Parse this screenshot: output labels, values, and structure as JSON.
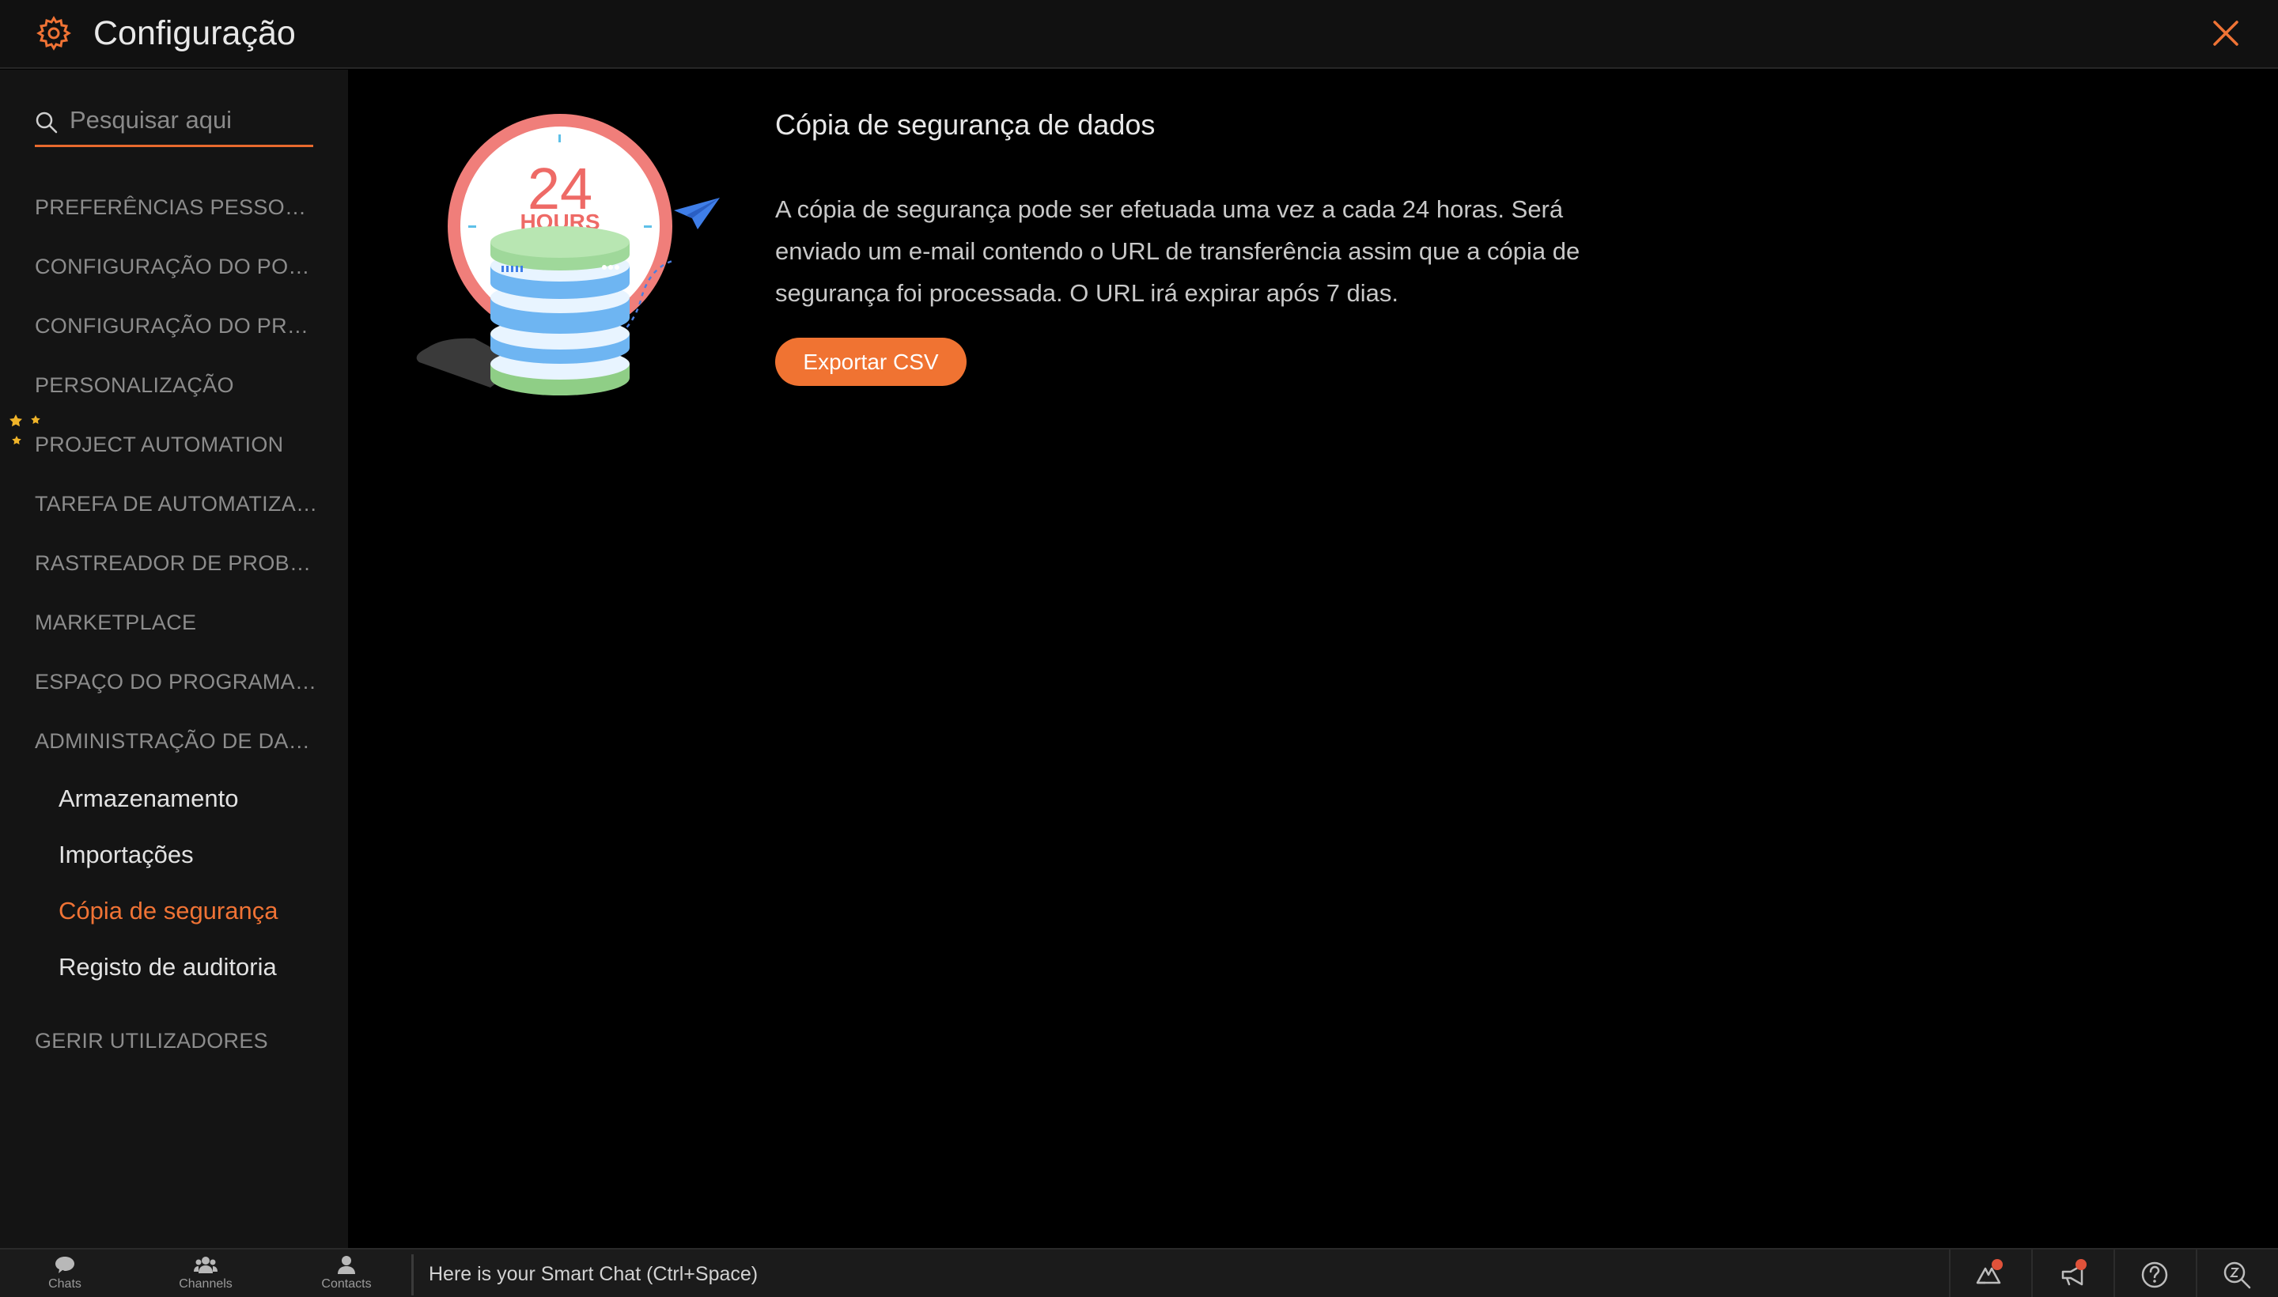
{
  "header": {
    "title": "Configuração",
    "accent_color": "#f07335",
    "gear_icon": "gear-icon",
    "close_icon": "close-icon"
  },
  "sidebar": {
    "search_placeholder": "Pesquisar aqui",
    "items": [
      {
        "label": "PREFERÊNCIAS PESSOAIS"
      },
      {
        "label": "CONFIGURAÇÃO DO POR..."
      },
      {
        "label": "CONFIGURAÇÃO DO PRO..."
      },
      {
        "label": "PERSONALIZAÇÃO"
      },
      {
        "label": "PROJECT AUTOMATION"
      },
      {
        "label": "TAREFA DE AUTOMATIZAÇ..."
      },
      {
        "label": "RASTREADOR DE PROBLE..."
      },
      {
        "label": "MARKETPLACE"
      },
      {
        "label": "ESPAÇO DO PROGRAMAD..."
      },
      {
        "label": "ADMINISTRAÇÃO DE DAD..."
      }
    ],
    "sub_items": [
      {
        "label": "Armazenamento",
        "active": false
      },
      {
        "label": "Importações",
        "active": false
      },
      {
        "label": "Cópia de segurança",
        "active": true
      },
      {
        "label": "Registo de auditoria",
        "active": false
      }
    ],
    "last_item": {
      "label": "GERIR UTILIZADORES"
    }
  },
  "main": {
    "illustration": {
      "number": "24",
      "unit": "HOURS"
    },
    "title": "Cópia de segurança de dados",
    "description": "A cópia de segurança pode ser efetuada uma vez a cada 24 horas. Será enviado um e-mail contendo o URL de transferência assim que a cópia de segurança foi processada. O URL irá expirar após 7 dias.",
    "export_button": "Exportar CSV"
  },
  "bottombar": {
    "tabs": [
      {
        "label": "Chats",
        "icon": "chat-icon"
      },
      {
        "label": "Channels",
        "icon": "channels-icon"
      },
      {
        "label": "Contacts",
        "icon": "contacts-icon"
      }
    ],
    "smartchat_text": "Here is your Smart Chat (Ctrl+Space)"
  }
}
